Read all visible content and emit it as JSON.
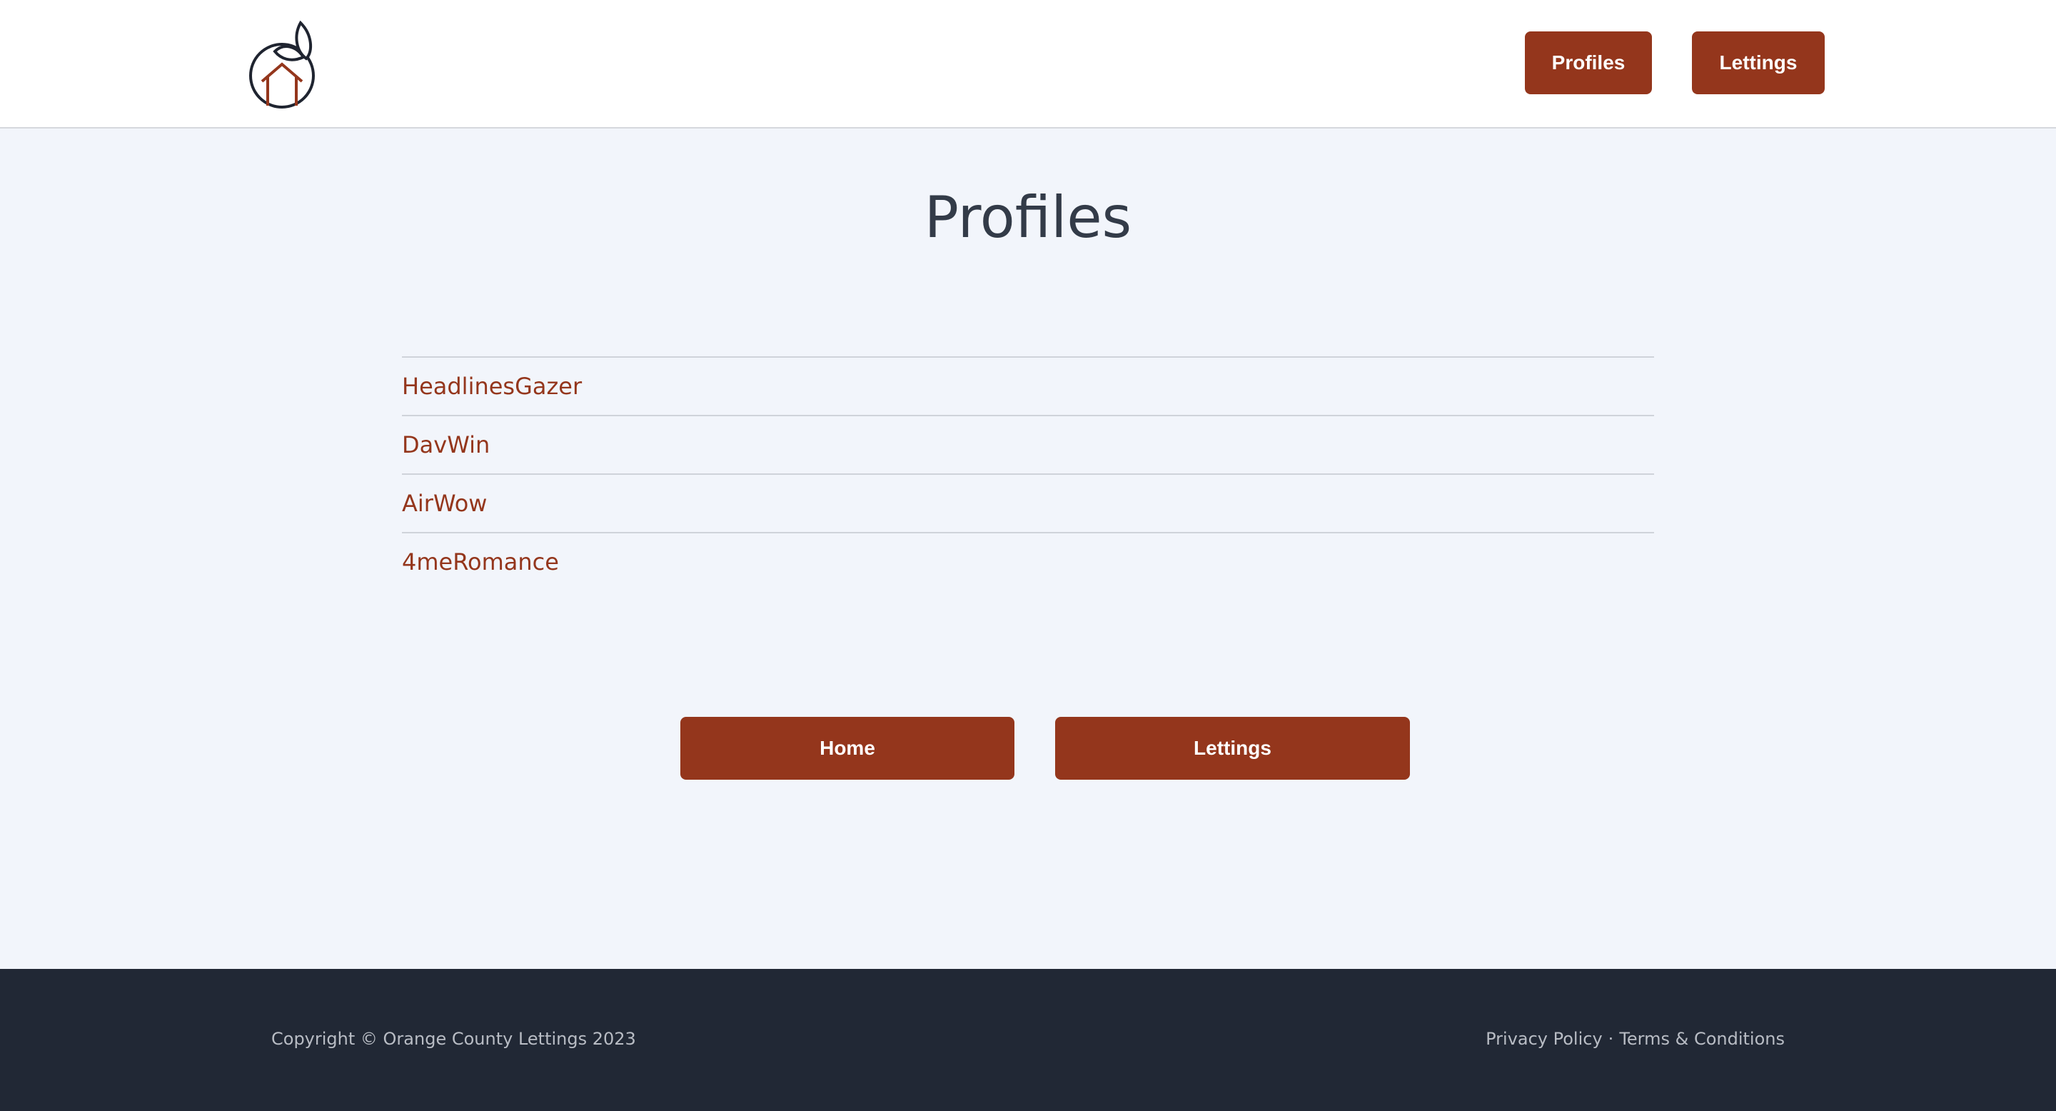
{
  "header": {
    "logo": "orange-house-logo",
    "nav": [
      {
        "label": "Profiles"
      },
      {
        "label": "Lettings"
      }
    ]
  },
  "main": {
    "title": "Profiles",
    "profiles": [
      "HeadlinesGazer",
      "DavWin",
      "AirWow",
      "4meRomance"
    ],
    "buttons": {
      "home": "Home",
      "lettings": "Lettings"
    }
  },
  "footer": {
    "copyright": "Copyright © Orange County Lettings 2023",
    "privacy": "Privacy Policy",
    "separator": "·",
    "terms": "Terms & Conditions"
  },
  "colors": {
    "accent": "#94361c",
    "background": "#f2f5fb",
    "footer": "#212835",
    "title": "#333b48"
  }
}
